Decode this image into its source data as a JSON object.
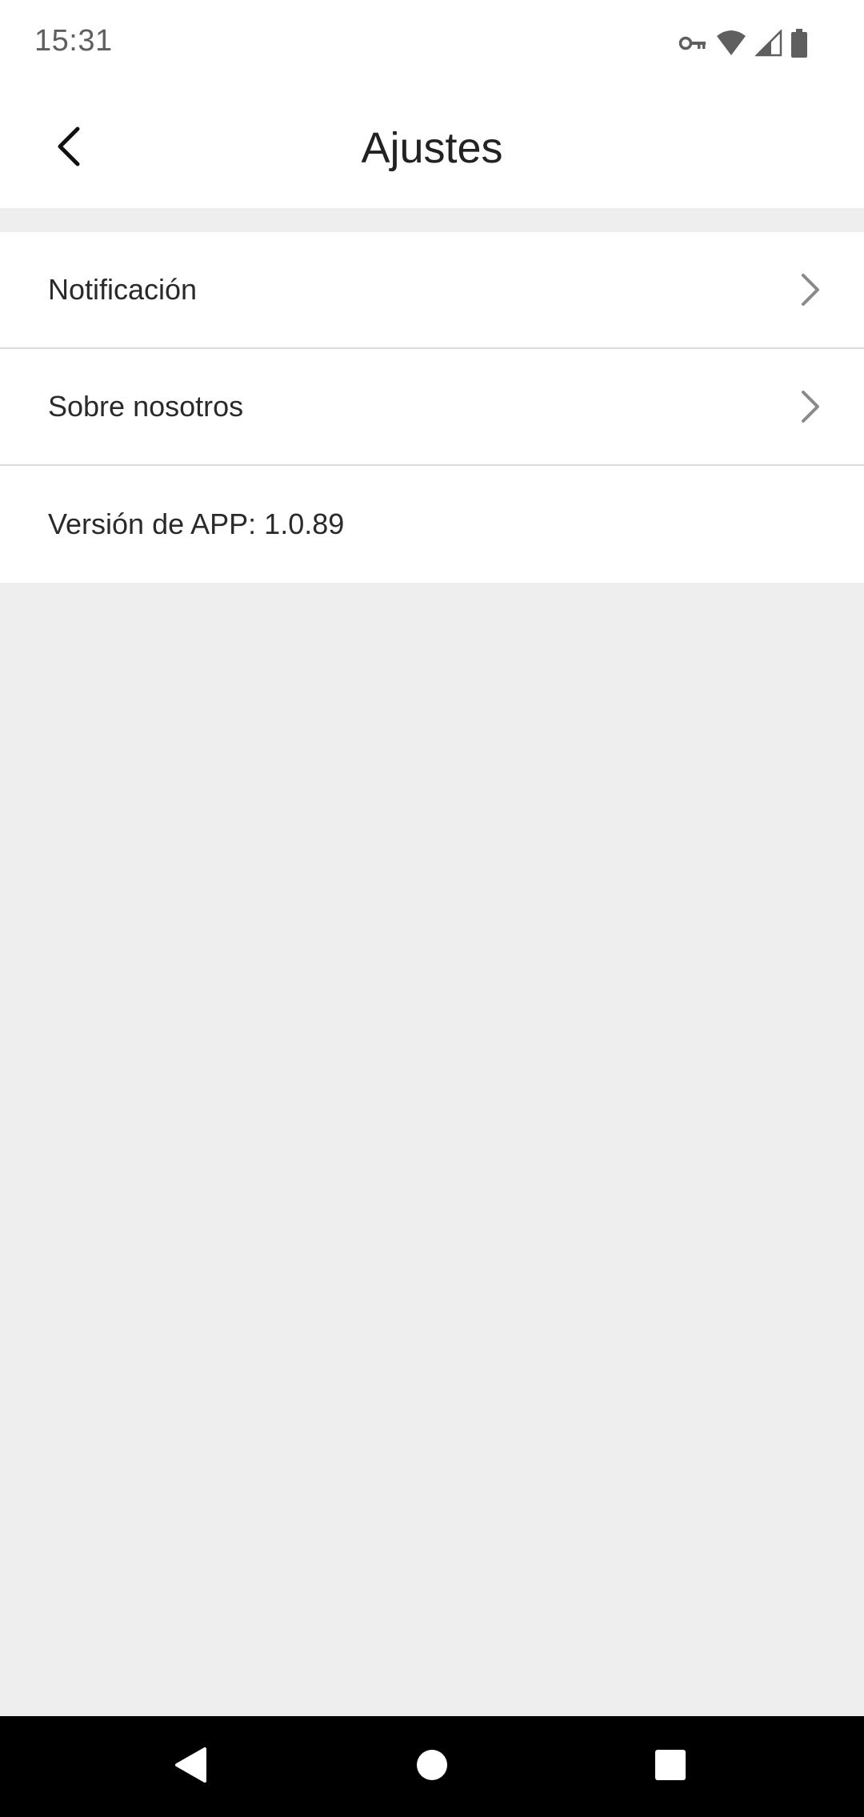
{
  "status_bar": {
    "time": "15:31",
    "icons": [
      "vpn-key-icon",
      "wifi-icon",
      "cellular-signal-icon",
      "battery-icon"
    ]
  },
  "app_bar": {
    "title": "Ajustes",
    "back_icon": "chevron-left-icon"
  },
  "settings": {
    "items": [
      {
        "label": "Notificación",
        "icon": "chevron-right-icon"
      },
      {
        "label": "Sobre nosotros",
        "icon": "chevron-right-icon"
      }
    ],
    "version_label": "Versión de APP: 1.0.89"
  },
  "nav_bar": {
    "buttons": [
      "back-triangle-icon",
      "home-circle-icon",
      "recents-square-icon"
    ]
  },
  "colors": {
    "background": "#eeeeee",
    "surface": "#ffffff",
    "divider": "#dcdcdc",
    "chevron": "#8a8a8a",
    "nav_bar": "#000000"
  }
}
